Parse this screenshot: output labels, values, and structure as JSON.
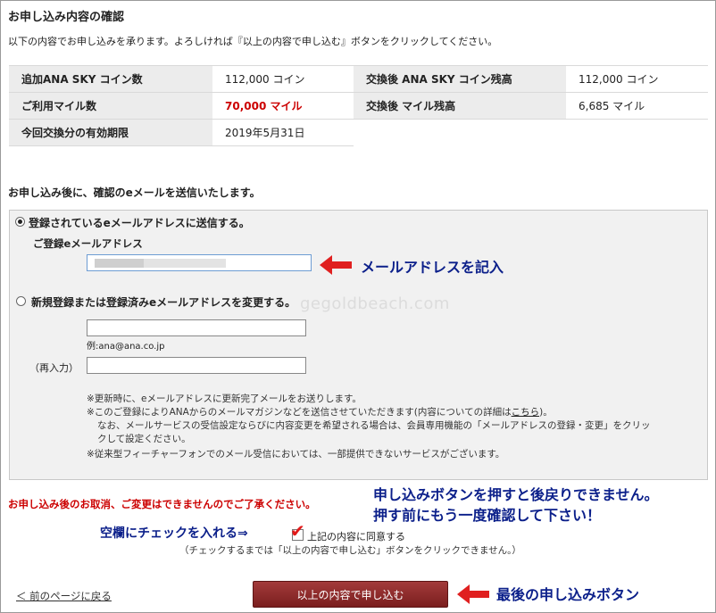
{
  "page": {
    "heading": "お申し込み内容の確認",
    "lead": "以下の内容でお申し込みを承ります。よろしければ『以上の内容で申し込む』ボタンをクリックしてください。"
  },
  "summary": {
    "rows": [
      {
        "label1": "追加ANA SKY コイン数",
        "value1": "112,000 コイン",
        "label2": "交換後 ANA SKY コイン残高",
        "value2": "112,000 コイン"
      },
      {
        "label1": "ご利用マイル数",
        "value1": "70,000 マイル",
        "label2": "交換後 マイル残高",
        "value2": "6,685 マイル"
      },
      {
        "label1": "今回交換分の有効期限",
        "value1": "2019年5月31日",
        "label2": "",
        "value2": ""
      }
    ]
  },
  "email": {
    "intro": "お申し込み後に、確認のeメールを送信いたします。",
    "option_registered": "登録されているeメールアドレスに送信する。",
    "registered_label": "ご登録eメールアドレス",
    "option_new": "新規登録または登録済みeメールアドレスを変更する。",
    "example": "例:ana@ana.co.jp",
    "reenter_label": "（再入力）",
    "notes": [
      "※更新時に、eメールアドレスに更新完了メールをお送りします。",
      "※このご登録によりANAからのメールマガジンなどを送信させていただきます(内容についての詳細は",
      "こちら",
      ")。",
      "なお、メールサービスの受信設定ならびに内容変更を希望される場合は、会員専用機能の「メールアドレスの登録・変更」をクリッ",
      "クして設定ください。",
      "※従来型フィーチャーフォンでのメール受信においては、一部提供できないサービスがございます。"
    ]
  },
  "watermark": "gegoldbeach.com",
  "warning": "お申し込み後のお取消、ご変更はできませんのでご了承ください。",
  "agree": {
    "label": "上記の内容に同意する",
    "hint": "（チェックするまでは「以上の内容で申し込む」ボタンをクリックできません。）",
    "checked": true
  },
  "nav": {
    "back": "＜ 前のページに戻る",
    "submit": "以上の内容で申し込む"
  },
  "annotations": {
    "email_hint": "メールアドレスを記入",
    "submit_warning_line1": "申し込みボタンを押すと後戻りできません。",
    "submit_warning_line2": "押す前にもう一度確認して下さい！",
    "check_hint": "空欄にチェックを入れる⇒",
    "final_button": "最後の申し込みボタン"
  },
  "colors": {
    "accent_red": "#cc0000",
    "annotation_blue": "#0b1f8a",
    "button": "#8e2b2b"
  }
}
